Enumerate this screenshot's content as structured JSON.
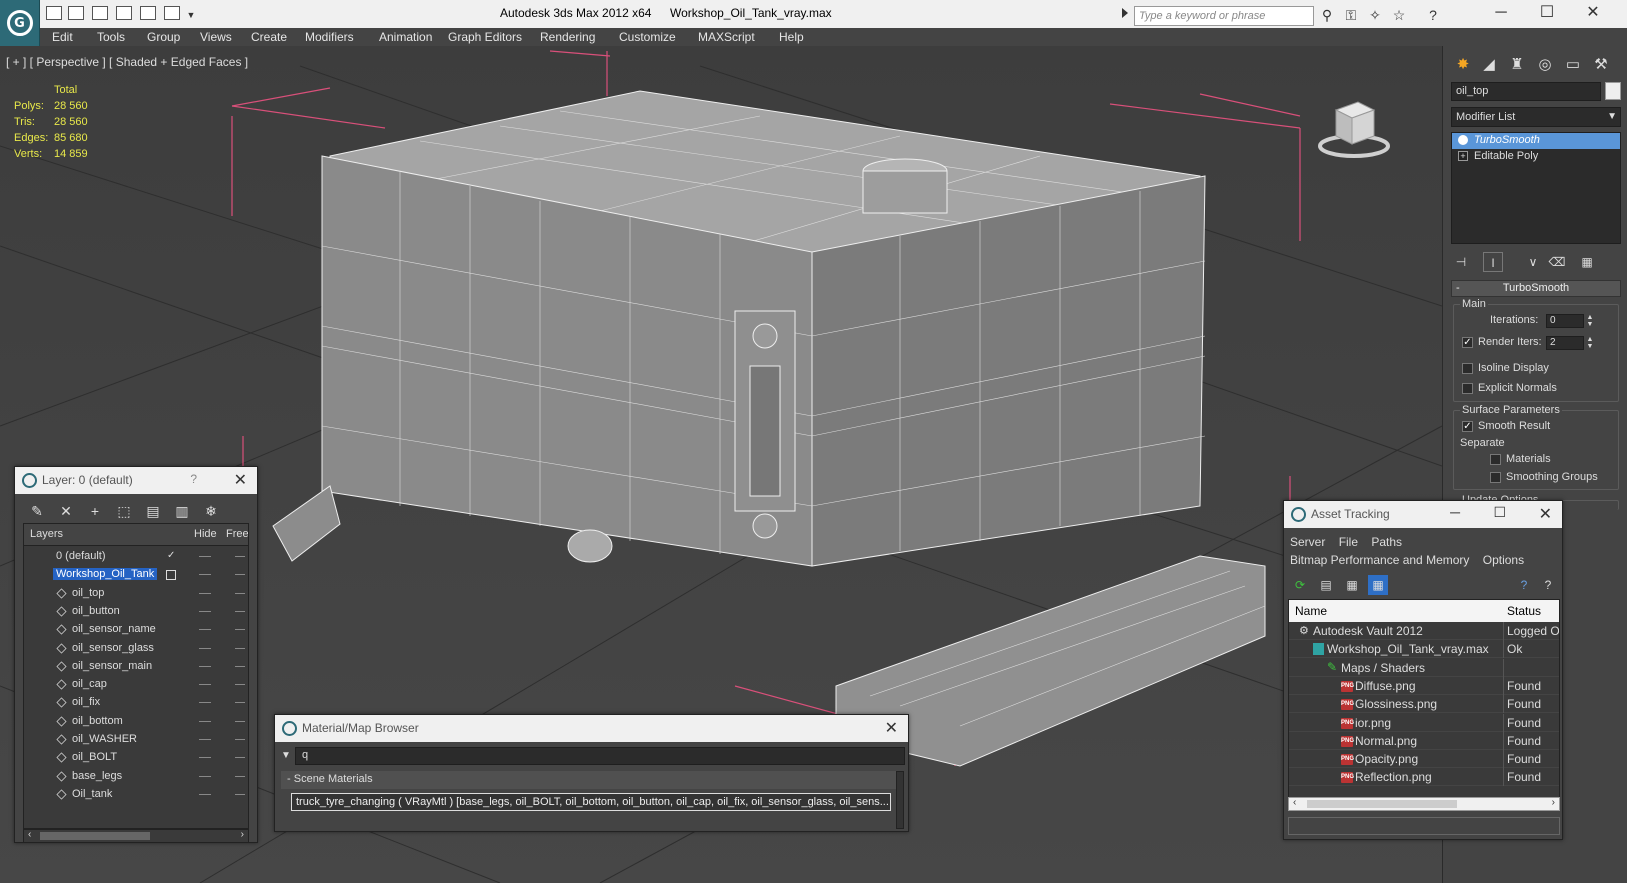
{
  "app": {
    "title": "Autodesk 3ds Max  2012 x64",
    "file": "Workshop_Oil_Tank_vray.max",
    "search_placeholder": "Type a keyword or phrase"
  },
  "menu": [
    "Edit",
    "Tools",
    "Group",
    "Views",
    "Create",
    "Modifiers",
    "Animation",
    "Graph Editors",
    "Rendering",
    "Customize",
    "MAXScript",
    "Help"
  ],
  "viewport": {
    "label": "[ + ] [ Perspective ] [ Shaded + Edged Faces ]",
    "stats": {
      "total_label": "Total",
      "rows": [
        {
          "label": "Polys:",
          "value": "28 560"
        },
        {
          "label": "Tris:",
          "value": "28 560"
        },
        {
          "label": "Edges:",
          "value": "85 680"
        },
        {
          "label": "Verts:",
          "value": "14 859"
        }
      ]
    }
  },
  "command_panel": {
    "object_name": "oil_top",
    "modifier_list_label": "Modifier List",
    "stack": [
      "TurboSmooth",
      "Editable Poly"
    ],
    "rollout": "TurboSmooth",
    "main_group": "Main",
    "iterations_label": "Iterations:",
    "iterations_value": "0",
    "render_iters_label": "Render Iters:",
    "render_iters_value": "2",
    "isoline_label": "Isoline Display",
    "explicit_normals_label": "Explicit Normals",
    "surface_group": "Surface Parameters",
    "smooth_result_label": "Smooth Result",
    "separate_label": "Separate",
    "materials_label": "Materials",
    "smoothing_groups_label": "Smoothing Groups",
    "update_options_label": "Update Options"
  },
  "layer_window": {
    "title": "Layer: 0 (default)",
    "help": "?",
    "columns": [
      "Layers",
      "Hide",
      "Free"
    ],
    "layers": [
      {
        "name": "0 (default)",
        "level": 1
      },
      {
        "name": "Workshop_Oil_Tank",
        "level": 1
      },
      {
        "name": "oil_top",
        "level": 2
      },
      {
        "name": "oil_button",
        "level": 2
      },
      {
        "name": "oil_sensor_name",
        "level": 2
      },
      {
        "name": "oil_sensor_glass",
        "level": 2
      },
      {
        "name": "oil_sensor_main",
        "level": 2
      },
      {
        "name": "oil_cap",
        "level": 2
      },
      {
        "name": "oil_fix",
        "level": 2
      },
      {
        "name": "oil_bottom",
        "level": 2
      },
      {
        "name": "oil_WASHER",
        "level": 2
      },
      {
        "name": "oil_BOLT",
        "level": 2
      },
      {
        "name": "base_legs",
        "level": 2
      },
      {
        "name": "Oil_tank",
        "level": 2
      }
    ]
  },
  "material_browser": {
    "title": "Material/Map Browser",
    "search_value": "q",
    "group_label": "Scene Materials",
    "item": "truck_tyre_changing ( VRayMtl ) [base_legs, oil_BOLT, oil_bottom, oil_button, oil_cap, oil_fix, oil_sensor_glass, oil_sens..."
  },
  "asset_tracking": {
    "title": "Asset Tracking",
    "menu_row1": [
      "Server",
      "File",
      "Paths"
    ],
    "menu_row2": [
      "Bitmap Performance and Memory",
      "Options"
    ],
    "columns": [
      "Name",
      "Status"
    ],
    "rows": [
      {
        "name": "Autodesk Vault 2012",
        "status": "Logged O",
        "indent": 1,
        "icon": "vault-icon"
      },
      {
        "name": "Workshop_Oil_Tank_vray.max",
        "status": "Ok",
        "indent": 2,
        "icon": "max-file-icon"
      },
      {
        "name": "Maps / Shaders",
        "status": "",
        "indent": 3,
        "icon": "maps-icon"
      },
      {
        "name": "Diffuse.png",
        "status": "Found",
        "indent": 4,
        "icon": "png-icon"
      },
      {
        "name": "Glossiness.png",
        "status": "Found",
        "indent": 4,
        "icon": "png-icon"
      },
      {
        "name": "ior.png",
        "status": "Found",
        "indent": 4,
        "icon": "png-icon"
      },
      {
        "name": "Normal.png",
        "status": "Found",
        "indent": 4,
        "icon": "png-icon"
      },
      {
        "name": "Opacity.png",
        "status": "Found",
        "indent": 4,
        "icon": "png-icon"
      },
      {
        "name": "Reflection.png",
        "status": "Found",
        "indent": 4,
        "icon": "png-icon"
      }
    ],
    "png_badge": "PNG"
  },
  "colors": {
    "selection": "#2563c4",
    "stack_selected": "#5a96d8",
    "stats_text": "#e8e84a",
    "bounding_box": "#d9507a"
  }
}
